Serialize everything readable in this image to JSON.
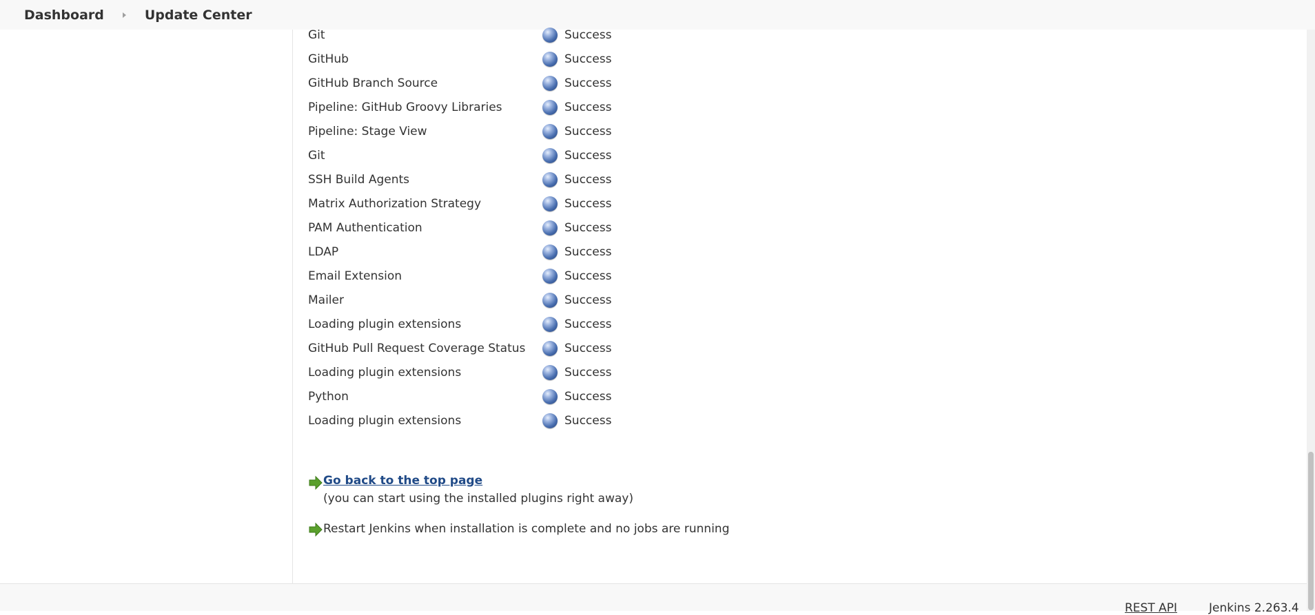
{
  "breadcrumb": {
    "items": [
      "Dashboard",
      "Update Center"
    ]
  },
  "plugins": [
    {
      "name": "Git",
      "status": "Success"
    },
    {
      "name": "GitHub",
      "status": "Success"
    },
    {
      "name": "GitHub Branch Source",
      "status": "Success"
    },
    {
      "name": "Pipeline: GitHub Groovy Libraries",
      "status": "Success"
    },
    {
      "name": "Pipeline: Stage View",
      "status": "Success"
    },
    {
      "name": "Git",
      "status": "Success"
    },
    {
      "name": "SSH Build Agents",
      "status": "Success"
    },
    {
      "name": "Matrix Authorization Strategy",
      "status": "Success"
    },
    {
      "name": "PAM Authentication",
      "status": "Success"
    },
    {
      "name": "LDAP",
      "status": "Success"
    },
    {
      "name": "Email Extension",
      "status": "Success"
    },
    {
      "name": "Mailer",
      "status": "Success"
    },
    {
      "name": "Loading plugin extensions",
      "status": "Success"
    },
    {
      "name": "GitHub Pull Request Coverage Status",
      "status": "Success"
    },
    {
      "name": "Loading plugin extensions",
      "status": "Success"
    },
    {
      "name": "Python",
      "status": "Success"
    },
    {
      "name": "Loading plugin extensions",
      "status": "Success"
    }
  ],
  "actions": {
    "top_page_link": "Go back to the top page",
    "top_page_note": "(you can start using the installed plugins right away)",
    "restart_text": "Restart Jenkins when installation is complete and no jobs are running"
  },
  "footer": {
    "rest_api": "REST API",
    "version": "Jenkins 2.263.4"
  },
  "colors": {
    "link": "#204a87",
    "arrow": "#5aa02c",
    "status_ball": "#4a6fb0"
  },
  "icons": {
    "status": "blue-ball-icon",
    "action": "green-arrow-icon",
    "separator": "chevron-right-icon"
  }
}
